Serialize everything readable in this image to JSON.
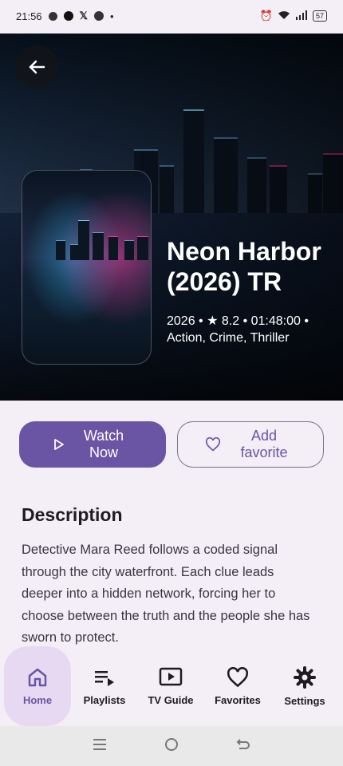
{
  "status_bar": {
    "time": "21:56",
    "battery": "57"
  },
  "hero": {
    "title": "Neon Harbor (2026) TR",
    "meta": "2026 • ★ 8.2 • 01:48:00 • Action, Crime, Thriller"
  },
  "actions": {
    "watch_label": "Watch Now",
    "favorite_label": "Add favorite"
  },
  "description": {
    "heading": "Description",
    "text": "Detective Mara Reed follows a coded signal through the city waterfront. Each clue leads deeper into a hidden network, forcing her to choose between the truth and the people she has sworn to protect."
  },
  "bottom_nav": {
    "items": [
      {
        "label": "Home",
        "icon": "home-icon",
        "active": true
      },
      {
        "label": "Playlists",
        "icon": "playlist-icon"
      },
      {
        "label": "TV Guide",
        "icon": "tv-guide-icon"
      },
      {
        "label": "Favorites",
        "icon": "heart-icon"
      },
      {
        "label": "Settings",
        "icon": "gear-icon"
      }
    ]
  },
  "colors": {
    "accent": "#6a55a5",
    "background": "#f4eef6",
    "active_nav": "#e7d9f1"
  }
}
